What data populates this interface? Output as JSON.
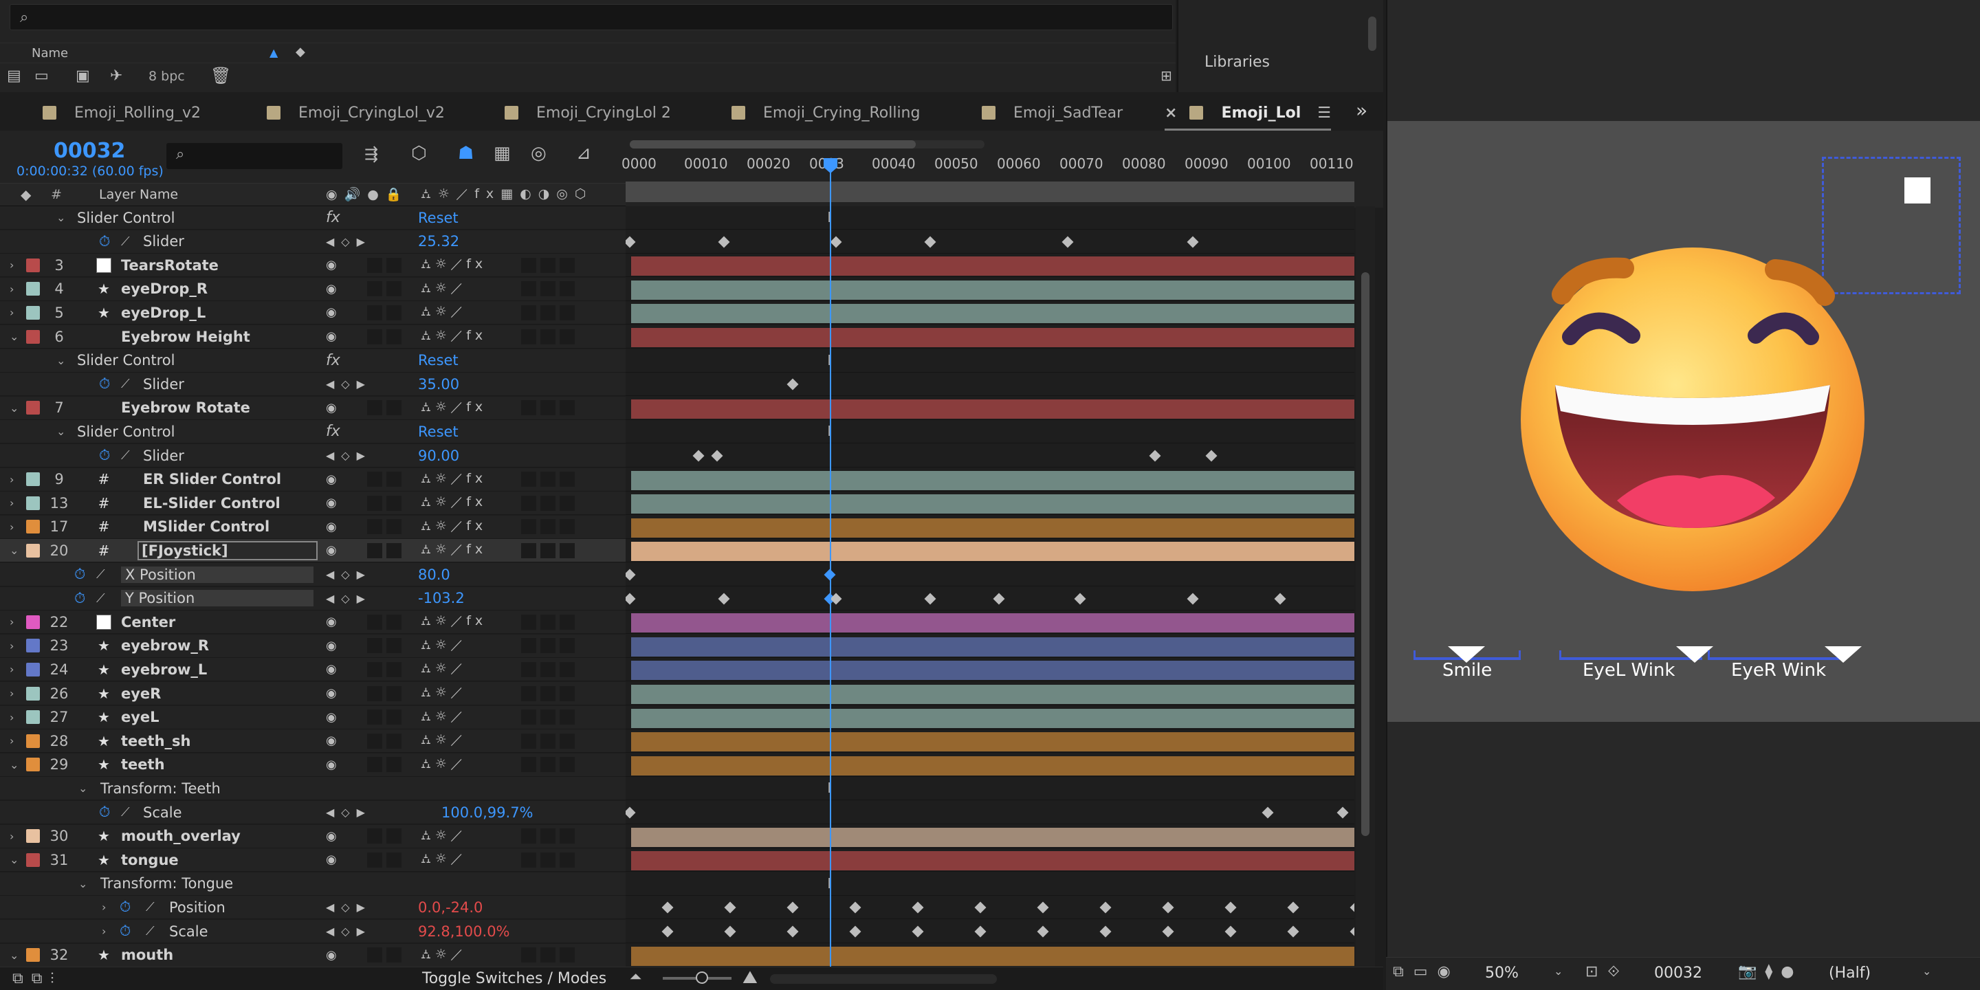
{
  "project": {
    "search_placeholder": "",
    "name_header": "Name",
    "bpc": "8 bpc",
    "libraries": "Libraries"
  },
  "tabs": [
    {
      "label": "Emoji_Rolling_v2",
      "active": false
    },
    {
      "label": "Emoji_CryingLol_v2",
      "active": false
    },
    {
      "label": "Emoji_CryingLol 2",
      "active": false
    },
    {
      "label": "Emoji_Crying_Rolling",
      "active": false
    },
    {
      "label": "Emoji_SadTear",
      "active": false
    },
    {
      "label": "Emoji_Lol",
      "active": true
    }
  ],
  "timeline": {
    "timecode": "00032",
    "subtime": "0:00:00:32 (60.00 fps)",
    "col_hash": "#",
    "col_layer_name": "Layer Name",
    "ruler_labels": [
      "0000",
      "00010",
      "00020",
      "0003",
      "00040",
      "00050",
      "00060",
      "00070",
      "00080",
      "00090",
      "00100",
      "00110"
    ],
    "current_frame": 32
  },
  "rows": [
    {
      "kind": "effect",
      "name": "Slider Control",
      "reset": "Reset"
    },
    {
      "kind": "prop",
      "name": "Slider",
      "value": "25.32",
      "keys": [
        0,
        15,
        33,
        48,
        70,
        90
      ]
    },
    {
      "kind": "layer",
      "num": "3",
      "name": "TearsRotate",
      "color": "#b84b4b",
      "type": "solid",
      "bar": "#8a3d3d",
      "twirl": "›"
    },
    {
      "kind": "layer",
      "num": "4",
      "name": "eyeDrop_R",
      "color": "#9cc5bf",
      "type": "star",
      "bar": "#6f8882",
      "twirl": "›"
    },
    {
      "kind": "layer",
      "num": "5",
      "name": "eyeDrop_L",
      "color": "#9cc5bf",
      "type": "star",
      "bar": "#6f8882",
      "twirl": "›"
    },
    {
      "kind": "layer",
      "num": "6",
      "name": "Eyebrow Height",
      "color": "#b84b4b",
      "type": "none",
      "bar": "#8a3d3d",
      "twirl": "⌄"
    },
    {
      "kind": "effect",
      "name": "Slider Control",
      "reset": "Reset"
    },
    {
      "kind": "prop",
      "name": "Slider",
      "value": "35.00",
      "keys": [
        26
      ]
    },
    {
      "kind": "layer",
      "num": "7",
      "name": "Eyebrow Rotate",
      "color": "#b84b4b",
      "type": "none",
      "bar": "#8a3d3d",
      "twirl": "⌄"
    },
    {
      "kind": "effect",
      "name": "Slider Control",
      "reset": "Reset"
    },
    {
      "kind": "prop",
      "name": "Slider",
      "value": "90.00",
      "keys": [
        11,
        14,
        84,
        93
      ]
    },
    {
      "kind": "layer",
      "num": "9",
      "name": "ER Slider Control",
      "color": "#9cc5bf",
      "type": "hash",
      "bar": "#6f8882",
      "twirl": "›"
    },
    {
      "kind": "layer",
      "num": "13",
      "name": "EL-Slider Control",
      "color": "#9cc5bf",
      "type": "hash",
      "bar": "#6f8882",
      "twirl": "›"
    },
    {
      "kind": "layer",
      "num": "17",
      "name": "MSlider Control",
      "color": "#e08e3c",
      "type": "hash",
      "bar": "#96672f",
      "twirl": "›"
    },
    {
      "kind": "layer",
      "num": "20",
      "name": "[FJoystick]",
      "color": "#e8c1a0",
      "type": "hash",
      "bar": "#d6a984",
      "twirl": "⌄",
      "selected": true
    },
    {
      "kind": "prop2",
      "name": "X Position",
      "value": "80.0",
      "keys": [
        0,
        32
      ]
    },
    {
      "kind": "prop2",
      "name": "Y Position",
      "value": "-103.2",
      "keys": [
        0,
        15,
        32,
        33,
        48,
        59,
        72,
        90,
        104
      ]
    },
    {
      "kind": "layer",
      "num": "22",
      "name": "Center",
      "color": "#e05ac1",
      "type": "solid",
      "bar": "#93568e",
      "twirl": "›"
    },
    {
      "kind": "layer",
      "num": "23",
      "name": "eyebrow_R",
      "color": "#6378c8",
      "type": "star",
      "bar": "#4f5d8d",
      "twirl": "›"
    },
    {
      "kind": "layer",
      "num": "24",
      "name": "eyebrow_L",
      "color": "#6378c8",
      "type": "star",
      "bar": "#4f5d8d",
      "twirl": "›"
    },
    {
      "kind": "layer",
      "num": "26",
      "name": "eyeR",
      "color": "#9cc5bf",
      "type": "star",
      "bar": "#6f8882",
      "twirl": "›"
    },
    {
      "kind": "layer",
      "num": "27",
      "name": "eyeL",
      "color": "#9cc5bf",
      "type": "star",
      "bar": "#6f8882",
      "twirl": "›"
    },
    {
      "kind": "layer",
      "num": "28",
      "name": "teeth_sh",
      "color": "#e08e3c",
      "type": "star",
      "bar": "#96672f",
      "twirl": "›"
    },
    {
      "kind": "layer",
      "num": "29",
      "name": "teeth",
      "color": "#e08e3c",
      "type": "star",
      "bar": "#96672f",
      "twirl": "⌄"
    },
    {
      "kind": "transform",
      "name": "Transform: Teeth"
    },
    {
      "kind": "prop",
      "name": "Scale",
      "value": "100.0,99.7%",
      "keys": [
        0,
        102,
        114
      ]
    },
    {
      "kind": "layer",
      "num": "30",
      "name": "mouth_overlay",
      "color": "#e8c1a0",
      "type": "star",
      "bar": "#a08a77",
      "twirl": "›"
    },
    {
      "kind": "layer",
      "num": "31",
      "name": "tongue",
      "color": "#b84b4b",
      "type": "star",
      "bar": "#8a3d3d",
      "twirl": "⌄"
    },
    {
      "kind": "transform",
      "name": "Transform: Tongue"
    },
    {
      "kind": "prop3",
      "name": "Position",
      "value": "0.0,-24.0",
      "keys": [
        6,
        16,
        26,
        36,
        46,
        56,
        66,
        76,
        86,
        96,
        106,
        116
      ]
    },
    {
      "kind": "prop3",
      "name": "Scale",
      "value": "92.8,100.0%",
      "keys": [
        6,
        16,
        26,
        36,
        46,
        56,
        66,
        76,
        86,
        96,
        106,
        116
      ]
    },
    {
      "kind": "layer",
      "num": "32",
      "name": "mouth",
      "color": "#e08e3c",
      "type": "star",
      "bar": "#96672f",
      "twirl": "⌄"
    }
  ],
  "footer": {
    "toggle_label": "Toggle Switches / Modes"
  },
  "viewer": {
    "controls": [
      {
        "label": "Smile"
      },
      {
        "label": "EyeL Wink"
      },
      {
        "label": "EyeR Wink"
      }
    ],
    "zoom": "50%",
    "frame": "00032",
    "resolution": "(Half)"
  },
  "colors": {
    "accent": "#3d97ff",
    "keyframe": "#bdbdbd",
    "value_red": "#e34b4b"
  }
}
